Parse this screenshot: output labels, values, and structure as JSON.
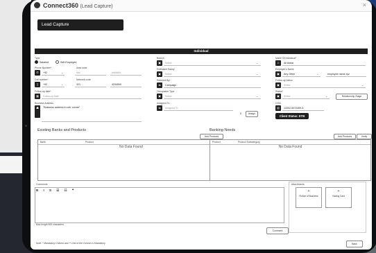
{
  "window": {
    "app_name": "Connect360",
    "subtitle": "(Lead Capture)",
    "close": "×"
  },
  "page": {
    "title": "Lead Capture"
  },
  "section": {
    "title": "Individual"
  },
  "form": {
    "type": {
      "label": "Type",
      "options": [
        "Salaried",
        "Self-Employed"
      ],
      "selected": "Salaried"
    },
    "phone": {
      "label": "Phone Number*",
      "code": "+92",
      "area_label": "Area code",
      "area_placeholder": "###",
      "number_placeholder": "#######"
    },
    "cell": {
      "label": "Cell number*",
      "code": "+92",
      "network_label": "Network code",
      "network": "321",
      "number": "4234500"
    },
    "followup_date": {
      "label": "Follow-up date*",
      "placeholder": "Follow-up Date"
    },
    "address": {
      "label": "Business Address",
      "value": "\"Business address in cell, corner\""
    },
    "branch": {
      "label": "Branch",
      "placeholder": "Select"
    },
    "est_salary": {
      "label": "Estimated Salary",
      "placeholder": "Select"
    },
    "referred_by": {
      "label": "Referred By*",
      "value": "Campaign"
    },
    "occupation": {
      "label": "Occupation Type",
      "placeholder": "Select"
    },
    "assigned_to": {
      "label": "Assigned To",
      "placeholder": "Assigned To",
      "assign_label": "Assign",
      "counter": "0"
    },
    "name_individual": {
      "label": "Name Of Individual*",
      "value": "Ali Akbar"
    },
    "employer": {
      "label": "Employer's Name",
      "value": "Any Other",
      "other_value": "employee name xyz"
    },
    "followup_action": {
      "label": "Follow-up Action",
      "placeholder": "Select"
    },
    "status": {
      "label": "Status*",
      "placeholder": "Select",
      "relationship_label": "Relationship Stage"
    },
    "cnic": {
      "label": "CNIC",
      "value": "13302-5072459-5"
    },
    "client_status": "Client Status: ETB"
  },
  "existing": {
    "title": "Existing Banks and Products",
    "add_label": "Add Products",
    "columns": [
      "Bank",
      "Product"
    ],
    "empty": "No Data Found"
  },
  "needs": {
    "title": "Banking Needs",
    "add_label": "Add Products",
    "verify_label": "Verify Products",
    "columns": [
      "Product",
      "Product Subcategory"
    ],
    "empty": "No Data Found"
  },
  "comments": {
    "label": "Comments",
    "toolbar": "B I S ☰ ☷ ❝",
    "max_length": "Max length 500 characters",
    "submit_label": "Comment"
  },
  "uploads": {
    "label": "Attachments",
    "items": [
      "Picture of Business",
      "Visiting Card"
    ]
  },
  "footer": {
    "note": "Note: * Mandatory Column and ** One of the Column is Mandatory",
    "back_label": "Back"
  }
}
